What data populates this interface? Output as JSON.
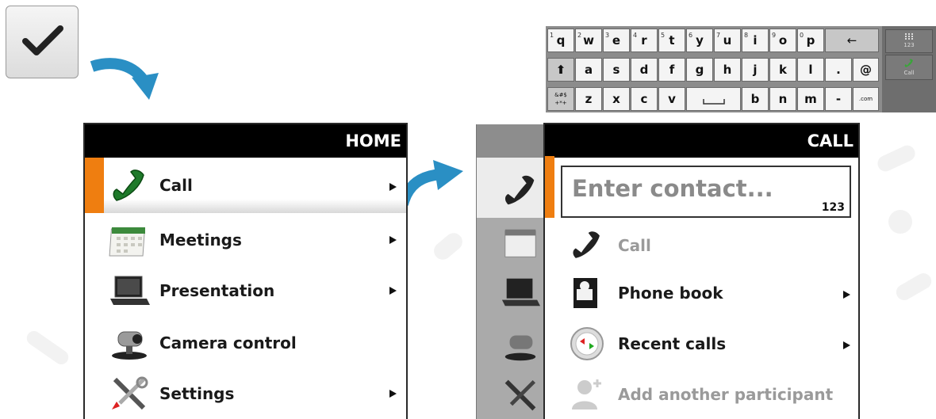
{
  "home_panel": {
    "title": "HOME",
    "items": [
      {
        "label": "Call",
        "icon": "phone-icon",
        "selected": true,
        "has_submenu": true
      },
      {
        "label": "Meetings",
        "icon": "calendar-icon",
        "selected": false,
        "has_submenu": true
      },
      {
        "label": "Presentation",
        "icon": "laptop-icon",
        "selected": false,
        "has_submenu": true
      },
      {
        "label": "Camera control",
        "icon": "camera-icon",
        "selected": false,
        "has_submenu": false
      },
      {
        "label": "Settings",
        "icon": "tools-icon",
        "selected": false,
        "has_submenu": true
      }
    ]
  },
  "call_panel": {
    "title": "CALL",
    "contact_placeholder": "Enter contact...",
    "contact_mode": "123",
    "items": [
      {
        "label": "Call",
        "icon": "phone-icon",
        "enabled": false,
        "has_submenu": false
      },
      {
        "label": "Phone book",
        "icon": "phonebook-icon",
        "enabled": true,
        "has_submenu": true
      },
      {
        "label": "Recent calls",
        "icon": "recent-calls-icon",
        "enabled": true,
        "has_submenu": true
      },
      {
        "label": "Add another participant",
        "icon": "add-participant-icon",
        "enabled": false,
        "has_submenu": false
      }
    ]
  },
  "keyboard": {
    "row1": [
      {
        "k": "q",
        "sup": "1"
      },
      {
        "k": "w",
        "sup": "2"
      },
      {
        "k": "e",
        "sup": "3"
      },
      {
        "k": "r",
        "sup": "4"
      },
      {
        "k": "t",
        "sup": "5"
      },
      {
        "k": "y",
        "sup": "6"
      },
      {
        "k": "u",
        "sup": "7"
      },
      {
        "k": "i",
        "sup": "8"
      },
      {
        "k": "o",
        "sup": "9"
      },
      {
        "k": "p",
        "sup": "0"
      }
    ],
    "backspace": "←",
    "row2": [
      "a",
      "s",
      "d",
      "f",
      "g",
      "h",
      "j",
      "k",
      "l",
      ".",
      "@"
    ],
    "shift": "⬆",
    "symbols": "&#$ +*+",
    "row3a": [
      "z",
      "x",
      "c",
      "v"
    ],
    "row3b": [
      "b",
      "n",
      "m",
      "-"
    ],
    "com": ".com",
    "side_numbers": "123",
    "side_call": "Call"
  },
  "colors": {
    "accent_orange": "#ef7e10",
    "arrow_blue": "#2a8fc4",
    "header_black": "#000000"
  }
}
